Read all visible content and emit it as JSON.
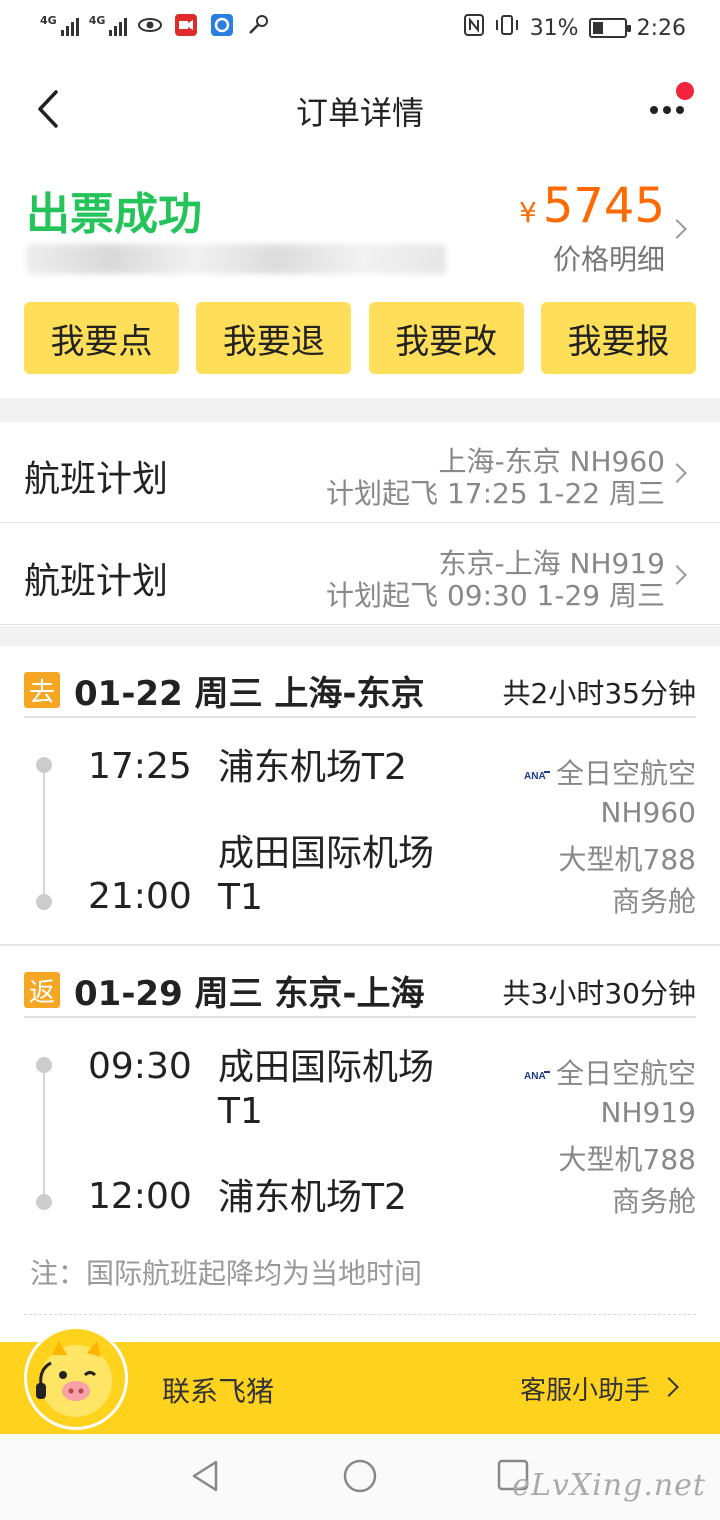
{
  "status_bar": {
    "net1": "4G",
    "net2": "4G",
    "battery": "31%",
    "time": "2:26",
    "icons": [
      "signal-icon",
      "signal-icon",
      "eye-icon",
      "video-app-icon",
      "browser-app-icon",
      "key-icon",
      "nfc-icon",
      "vibrate-icon",
      "battery-icon"
    ]
  },
  "header": {
    "title": "订单详情",
    "back_icon": "back-chevron-icon",
    "more_icon": "more-dots-icon"
  },
  "order": {
    "status": "出票成功",
    "currency": "¥",
    "price": "5745",
    "price_detail": "价格明细"
  },
  "actions": [
    {
      "label": "我要点"
    },
    {
      "label": "我要退"
    },
    {
      "label": "我要改"
    },
    {
      "label": "我要报"
    }
  ],
  "flight_plans": [
    {
      "label": "航班计划",
      "route": "上海-东京 NH960",
      "schedule": "计划起飞 17:25 1-22 周三"
    },
    {
      "label": "航班计划",
      "route": "东京-上海 NH919",
      "schedule": "计划起飞 09:30 1-29 周三"
    }
  ],
  "segments": [
    {
      "tag": "去",
      "title": "01-22 周三 上海-东京",
      "duration": "共2小时35分钟",
      "dep_time": "17:25",
      "dep_airport": "浦东机场T2",
      "arr_time": "21:00",
      "arr_airport_line1": "成田国际机场",
      "arr_airport_line2": "T1",
      "airline": "全日空航空",
      "flight_no": "NH960",
      "aircraft": "大型机788",
      "cabin": "商务舱"
    },
    {
      "tag": "返",
      "title": "01-29 周三 东京-上海",
      "duration": "共3小时30分钟",
      "dep_time": "09:30",
      "dep_airport_line1": "成田国际机场",
      "dep_airport_line2": "T1",
      "arr_time": "12:00",
      "arr_airport": "浦东机场T2",
      "airline": "全日空航空",
      "flight_no": "NH919",
      "aircraft": "大型机788",
      "cabin": "商务舱"
    }
  ],
  "note": "注：国际航班起降均为当地时间",
  "contact": {
    "label": "联系飞猪",
    "helper": "客服小助手",
    "mascot_icon": "fliggy-mascot-icon"
  },
  "watermark": "eLvXing.net",
  "colors": {
    "success": "#24c45a",
    "price": "#ff6a00",
    "button_bg": "#ffde5a",
    "tag_bg": "#f5a623",
    "contact_bg": "#ffd21e",
    "badge_red": "#f0243d"
  }
}
